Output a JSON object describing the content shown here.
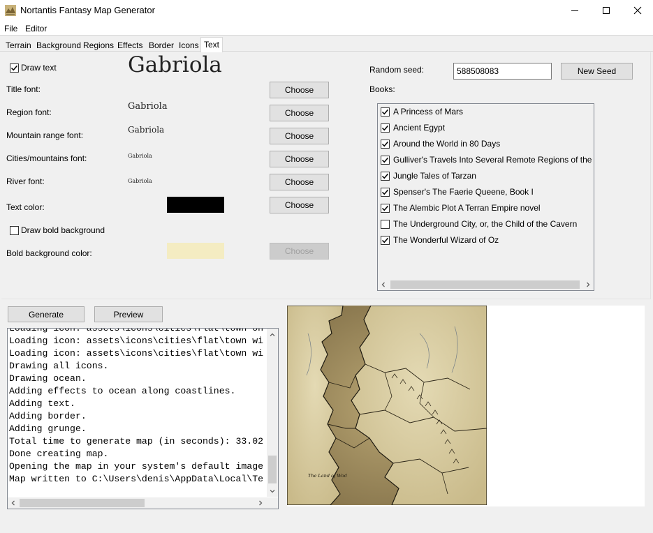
{
  "window": {
    "title": "Nortantis Fantasy Map Generator"
  },
  "menu": [
    "File",
    "Editor"
  ],
  "tabs": [
    "Terrain",
    "Background",
    "Regions",
    "Effects",
    "Border",
    "Icons",
    "Text"
  ],
  "active_tab": "Text",
  "text_settings": {
    "draw_text_label": "Draw text",
    "draw_text_checked": true,
    "title_font_label": "Title font:",
    "title_font_preview": "Gabriola",
    "region_font_label": "Region font:",
    "region_font_preview": "Gabriola",
    "mountain_font_label": "Mountain range font:",
    "mountain_font_preview": "Gabriola",
    "cities_font_label": "Cities/mountains font:",
    "cities_font_preview": "Gabriola",
    "river_font_label": "River font:",
    "river_font_preview": "Gabriola",
    "text_color_label": "Text color:",
    "text_color": "#000000",
    "draw_bold_bg_label": "Draw bold background",
    "draw_bold_bg_checked": false,
    "bold_bg_color_label": "Bold background color:",
    "bold_bg_color": "#f4ecc2",
    "choose_label": "Choose"
  },
  "seed": {
    "label": "Random seed:",
    "value": "588508083",
    "new_seed_label": "New Seed"
  },
  "books": {
    "label": "Books:",
    "items": [
      {
        "title": "A Princess of Mars",
        "checked": true
      },
      {
        "title": "Ancient Egypt",
        "checked": true
      },
      {
        "title": "Around the World in 80 Days",
        "checked": true
      },
      {
        "title": "Gulliver's Travels Into Several Remote Regions of the World",
        "checked": true
      },
      {
        "title": "Jungle Tales of Tarzan",
        "checked": true
      },
      {
        "title": "Spenser's The Faerie Queene, Book I",
        "checked": true
      },
      {
        "title": "The Alembic Plot A Terran Empire novel",
        "checked": true
      },
      {
        "title": "The Underground City, or, the Child of the Cavern",
        "checked": false
      },
      {
        "title": "The Wonderful Wizard of Oz",
        "checked": true
      }
    ]
  },
  "actions": {
    "generate_label": "Generate",
    "preview_label": "Preview"
  },
  "log": [
    "Loading icon: assets\\icons\\cities\\flat\\town on",
    "Loading icon: assets\\icons\\cities\\flat\\town wi",
    "Loading icon: assets\\icons\\cities\\flat\\town wi",
    "Drawing all icons.",
    "Drawing ocean.",
    "Adding effects to ocean along coastlines.",
    "Adding text.",
    "Adding border.",
    "Adding grunge.",
    "Total time to generate map (in seconds): 33.02",
    "Done creating map.",
    "Opening the map in your system's default image",
    "Map written to C:\\Users\\denis\\AppData\\Local\\Te"
  ],
  "map": {
    "region_label": "The Land of Wod",
    "land_color": "#d9cda2",
    "ocean_color": "#8a7750"
  }
}
